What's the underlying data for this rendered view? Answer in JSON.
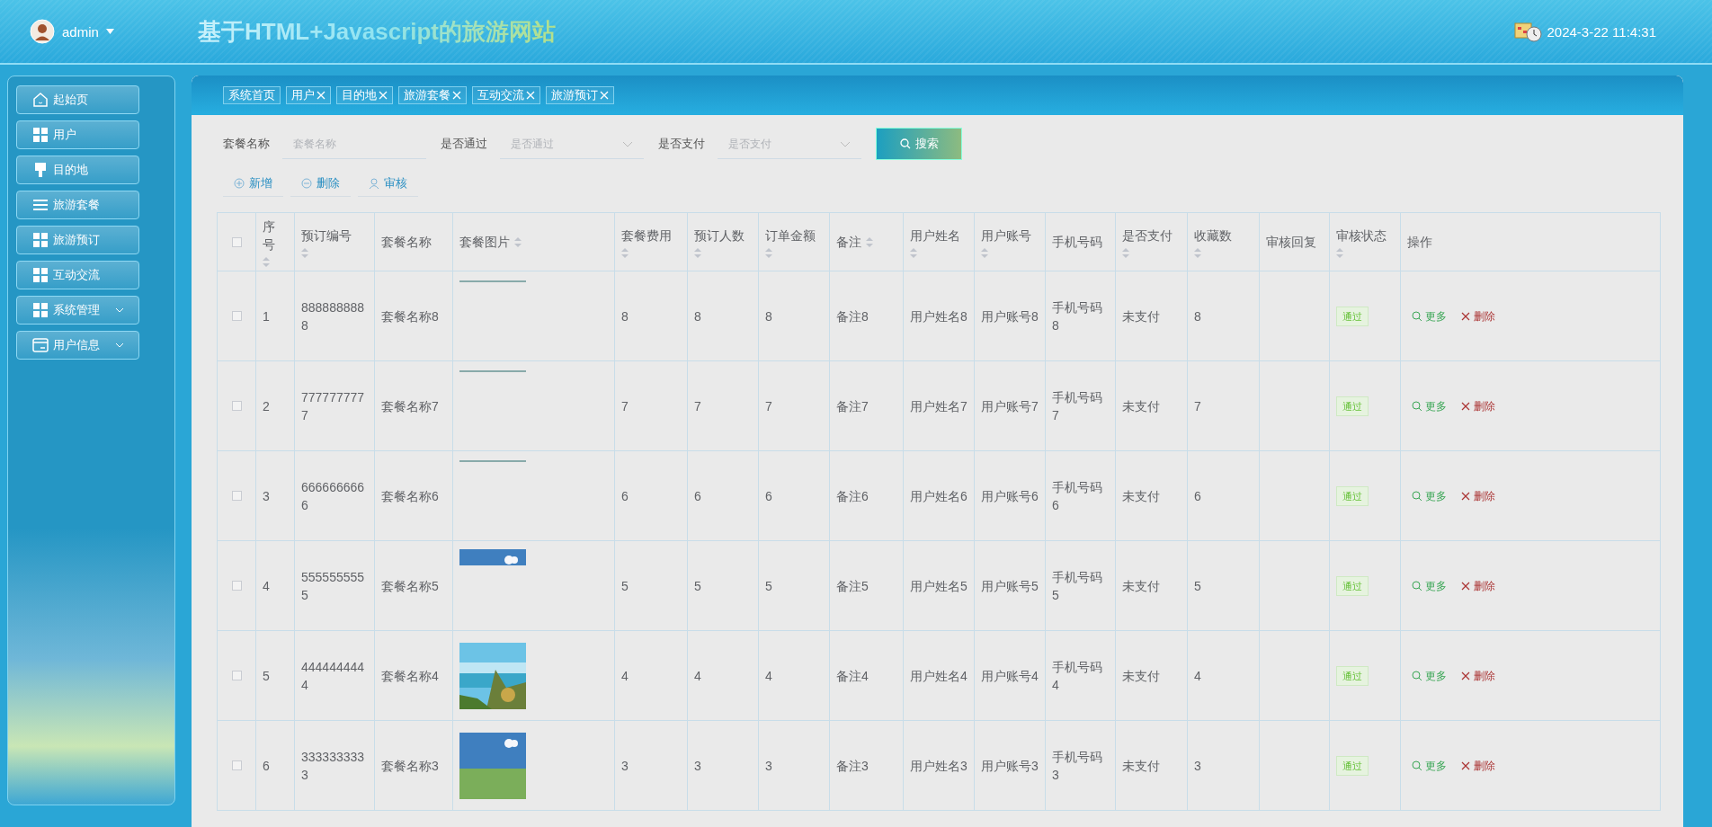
{
  "header": {
    "user": "admin",
    "title": "基于HTML+Javascript的旅游网站",
    "datetime": "2024-3-22 11:4:31"
  },
  "sidebar": {
    "items": [
      {
        "label": "起始页",
        "kind": "link"
      },
      {
        "label": "用户",
        "kind": "link"
      },
      {
        "label": "目的地",
        "kind": "link"
      },
      {
        "label": "旅游套餐",
        "kind": "link"
      },
      {
        "label": "旅游预订",
        "kind": "link"
      },
      {
        "label": "互动交流",
        "kind": "link"
      },
      {
        "label": "系统管理",
        "kind": "group",
        "expanded": false
      },
      {
        "label": "用户信息",
        "kind": "group",
        "expanded": false
      }
    ]
  },
  "tabs": [
    {
      "label": "系统首页",
      "closable": false
    },
    {
      "label": "用户",
      "closable": true
    },
    {
      "label": "目的地",
      "closable": true
    },
    {
      "label": "旅游套餐",
      "closable": true
    },
    {
      "label": "互动交流",
      "closable": true
    },
    {
      "label": "旅游预订",
      "closable": true
    }
  ],
  "search": {
    "fields": [
      {
        "label": "套餐名称",
        "placeholder": "套餐名称",
        "kind": "input"
      },
      {
        "label": "是否通过",
        "placeholder": "是否通过",
        "kind": "select"
      },
      {
        "label": "是否支付",
        "placeholder": "是否支付",
        "kind": "select"
      }
    ],
    "button": "搜索"
  },
  "actions": [
    {
      "label": "新增",
      "kind": "add"
    },
    {
      "label": "删除",
      "kind": "delete"
    },
    {
      "label": "审核",
      "kind": "audit"
    }
  ],
  "table": {
    "all_checked": false,
    "columns": [
      {
        "label": "序号",
        "sortable": true
      },
      {
        "label": "预订编号",
        "sortable": true
      },
      {
        "label": "套餐名称",
        "sortable": false
      },
      {
        "label": "套餐图片",
        "sortable": true
      },
      {
        "label": "套餐费用",
        "sortable": true
      },
      {
        "label": "预订人数",
        "sortable": true
      },
      {
        "label": "订单金额",
        "sortable": true
      },
      {
        "label": "备注",
        "sortable": true
      },
      {
        "label": "用户姓名",
        "sortable": true
      },
      {
        "label": "用户账号",
        "sortable": true
      },
      {
        "label": "手机号码",
        "sortable": false
      },
      {
        "label": "是否支付",
        "sortable": true
      },
      {
        "label": "收藏数",
        "sortable": true
      },
      {
        "label": "审核回复",
        "sortable": false
      },
      {
        "label": "审核状态",
        "sortable": true
      },
      {
        "label": "操作",
        "sortable": false
      }
    ],
    "rows": [
      {
        "checked": false,
        "cells": [
          "1",
          "8888888888",
          "套餐名称8",
          "",
          "8",
          "8",
          "8",
          "备注8",
          "用户姓名8",
          "用户账号8",
          "手机号码8",
          "未支付",
          "8",
          ""
        ],
        "image": {
          "kind": "loading"
        },
        "status": "通过",
        "more": "更多",
        "delete": "删除"
      },
      {
        "checked": false,
        "cells": [
          "2",
          "7777777777",
          "套餐名称7",
          "",
          "7",
          "7",
          "7",
          "备注7",
          "用户姓名7",
          "用户账号7",
          "手机号码7",
          "未支付",
          "7",
          ""
        ],
        "image": {
          "kind": "loading"
        },
        "status": "通过",
        "more": "更多",
        "delete": "删除"
      },
      {
        "checked": false,
        "cells": [
          "3",
          "6666666666",
          "套餐名称6",
          "",
          "6",
          "6",
          "6",
          "备注6",
          "用户姓名6",
          "用户账号6",
          "手机号码6",
          "未支付",
          "6",
          ""
        ],
        "image": {
          "kind": "loading"
        },
        "status": "通过",
        "more": "更多",
        "delete": "删除"
      },
      {
        "checked": false,
        "cells": [
          "4",
          "5555555555",
          "套餐名称5",
          "",
          "5",
          "5",
          "5",
          "备注5",
          "用户姓名5",
          "用户账号5",
          "手机号码5",
          "未支付",
          "5",
          ""
        ],
        "image": {
          "kind": "partial"
        },
        "status": "通过",
        "more": "更多",
        "delete": "删除"
      },
      {
        "checked": false,
        "cells": [
          "5",
          "4444444444",
          "套餐名称4",
          "",
          "4",
          "4",
          "4",
          "备注4",
          "用户姓名4",
          "用户账号4",
          "手机号码4",
          "未支付",
          "4",
          ""
        ],
        "status": "通过",
        "more": "更多",
        "delete": "删除"
      },
      {
        "checked": false,
        "cells": [
          "6",
          "3333333333",
          "套餐名称3",
          "",
          "3",
          "3",
          "3",
          "备注3",
          "用户姓名3",
          "用户账号3",
          "手机号码3",
          "未支付",
          "3",
          ""
        ],
        "status": "通过",
        "more": "更多",
        "delete": "删除"
      }
    ]
  }
}
